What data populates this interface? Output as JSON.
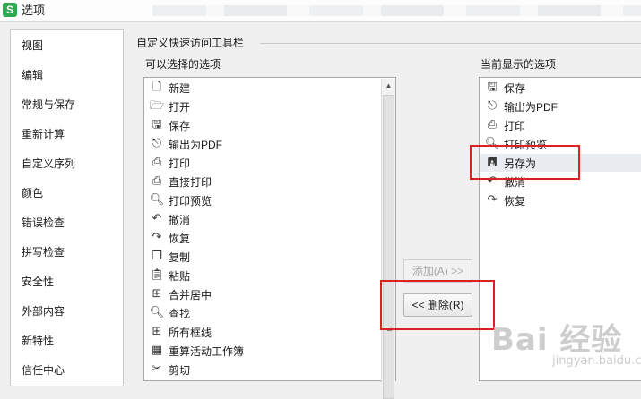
{
  "window": {
    "app_icon_letter": "S",
    "title": "选项"
  },
  "sidebar": {
    "items": [
      {
        "label": "视图"
      },
      {
        "label": "编辑"
      },
      {
        "label": "常规与保存"
      },
      {
        "label": "重新计算"
      },
      {
        "label": "自定义序列"
      },
      {
        "label": "颜色"
      },
      {
        "label": "错误检查"
      },
      {
        "label": "拼写检查"
      },
      {
        "label": "安全性"
      },
      {
        "label": "外部内容"
      },
      {
        "label": "新特性"
      },
      {
        "label": "信任中心"
      }
    ]
  },
  "section": {
    "title": "自定义快速访问工具栏"
  },
  "available": {
    "label": "可以选择的选项",
    "items": [
      {
        "icon": "new-doc-icon",
        "label": "新建"
      },
      {
        "icon": "open-folder-icon",
        "label": "打开"
      },
      {
        "icon": "save-icon",
        "label": "保存"
      },
      {
        "icon": "export-pdf-icon",
        "label": "输出为PDF"
      },
      {
        "icon": "print-icon",
        "label": "打印"
      },
      {
        "icon": "direct-print-icon",
        "label": "直接打印"
      },
      {
        "icon": "print-preview-icon",
        "label": "打印预览"
      },
      {
        "icon": "undo-icon",
        "label": "撤消"
      },
      {
        "icon": "redo-icon",
        "label": "恢复"
      },
      {
        "icon": "copy-icon",
        "label": "复制"
      },
      {
        "icon": "paste-icon",
        "label": "粘贴"
      },
      {
        "icon": "merge-center-icon",
        "label": "合并居中"
      },
      {
        "icon": "find-icon",
        "label": "查找"
      },
      {
        "icon": "all-borders-icon",
        "label": "所有框线"
      },
      {
        "icon": "recalc-sheet-icon",
        "label": "重算活动工作簿"
      },
      {
        "icon": "cut-icon",
        "label": "剪切"
      }
    ]
  },
  "current": {
    "label": "当前显示的选项",
    "selected_index": 4,
    "items": [
      {
        "icon": "save-icon",
        "label": "保存"
      },
      {
        "icon": "export-pdf-icon",
        "label": "输出为PDF"
      },
      {
        "icon": "print-icon",
        "label": "打印"
      },
      {
        "icon": "print-preview-icon",
        "label": "打印预览"
      },
      {
        "icon": "save-as-icon",
        "label": "另存为"
      },
      {
        "icon": "undo-icon",
        "label": "撤消"
      },
      {
        "icon": "redo-icon",
        "label": "恢复"
      }
    ]
  },
  "buttons": {
    "add": "添加(A) >>",
    "remove": "<< 删除(R)",
    "add_enabled": false
  },
  "scrollbar": {
    "up": "▲"
  },
  "watermark": {
    "main": "Bai 经验",
    "sub": "jingyan.baidu.com"
  },
  "colors": {
    "highlight": "#e02020",
    "selected_row": "#e9ecf1",
    "logo": "#2fa84f"
  }
}
